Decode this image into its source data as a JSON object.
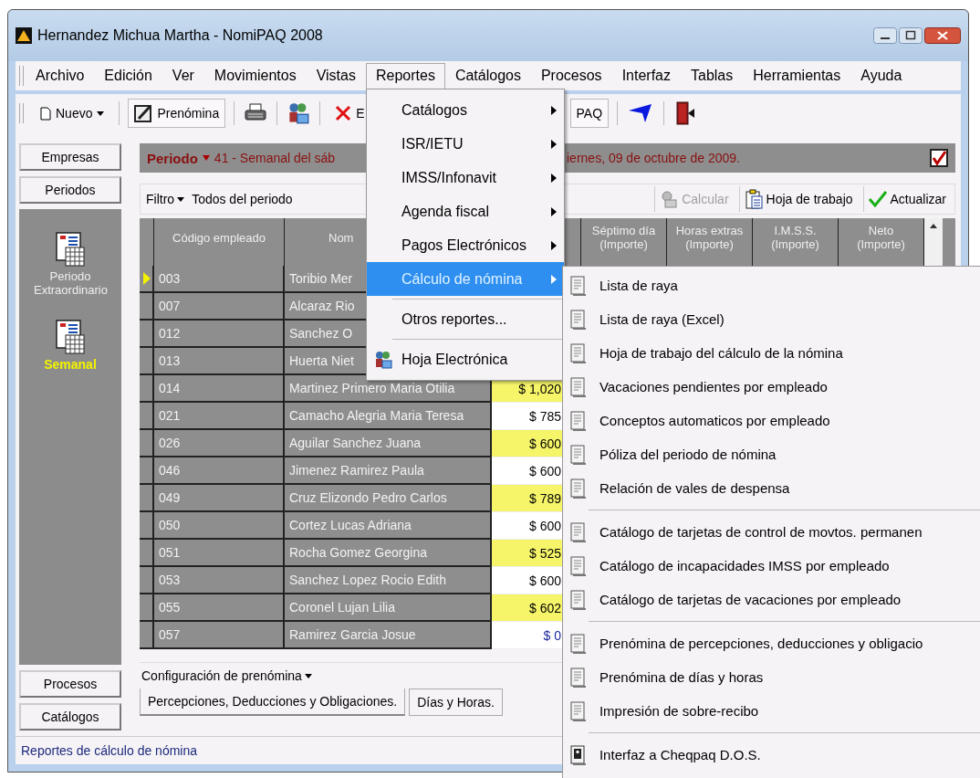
{
  "window": {
    "title": "Hernandez Michua Martha - NomiPAQ 2008"
  },
  "menubar": [
    {
      "label": "Archivo",
      "selected": false
    },
    {
      "label": "Edición",
      "selected": false
    },
    {
      "label": "Ver",
      "selected": false
    },
    {
      "label": "Movimientos",
      "selected": false
    },
    {
      "label": "Vistas",
      "selected": false
    },
    {
      "label": "Reportes",
      "selected": true
    },
    {
      "label": "Catálogos",
      "selected": false
    },
    {
      "label": "Procesos",
      "selected": false
    },
    {
      "label": "Interfaz",
      "selected": false
    },
    {
      "label": "Tablas",
      "selected": false
    },
    {
      "label": "Herramientas",
      "selected": false
    },
    {
      "label": "Ayuda",
      "selected": false
    }
  ],
  "reports_menu": [
    {
      "kind": "submenu",
      "label": "Catálogos",
      "selected": false
    },
    {
      "kind": "submenu",
      "label": "ISR/IETU",
      "selected": false
    },
    {
      "kind": "submenu",
      "label": "IMSS/Infonavit",
      "selected": false
    },
    {
      "kind": "submenu",
      "label": "Agenda fiscal",
      "selected": false
    },
    {
      "kind": "submenu",
      "label": "Pagos Electrónicos",
      "selected": false
    },
    {
      "kind": "submenu",
      "label": "Cálculo de nómina",
      "selected": true
    },
    {
      "kind": "separator"
    },
    {
      "kind": "command",
      "label": "Otros reportes...",
      "selected": false
    },
    {
      "kind": "separator"
    },
    {
      "kind": "icon-command",
      "label": "Hoja Electrónica",
      "selected": false
    }
  ],
  "payroll_submenu": [
    {
      "kind": "report",
      "label": "Lista de raya"
    },
    {
      "kind": "report",
      "label": "Lista de raya (Excel)"
    },
    {
      "kind": "report",
      "label": "Hoja de trabajo del cálculo de la nómina"
    },
    {
      "kind": "report",
      "label": "Vacaciones pendientes por empleado"
    },
    {
      "kind": "report",
      "label": "Conceptos automaticos por empleado"
    },
    {
      "kind": "report",
      "label": "Póliza del periodo de nómina"
    },
    {
      "kind": "report",
      "label": "Relación de vales de despensa"
    },
    {
      "kind": "separator"
    },
    {
      "kind": "report",
      "label": "Catálogo de tarjetas de control de movtos. permanen"
    },
    {
      "kind": "report",
      "label": "Catálogo de incapacidades IMSS por empleado"
    },
    {
      "kind": "report",
      "label": "Catálogo de tarjetas de vacaciones por empleado"
    },
    {
      "kind": "separator"
    },
    {
      "kind": "report",
      "label": "Prenómina de percepciones, deducciones y obligacio"
    },
    {
      "kind": "report",
      "label": "Prenómina de días y horas"
    },
    {
      "kind": "report",
      "label": "Impresión de sobre-recibo"
    },
    {
      "kind": "separator"
    },
    {
      "kind": "interface",
      "label": "Interfaz a Cheqpaq D.O.S."
    }
  ],
  "toolbar": {
    "new": "Nuevo",
    "prenomina": "Prenómina",
    "delete_partial": "E",
    "partial": "PAQ"
  },
  "sidebar": {
    "top_buttons": [
      "Empresas",
      "Periodos"
    ],
    "periods": [
      {
        "label": "Periodo Extraordinario",
        "selected": false
      },
      {
        "label": "Semanal",
        "selected": true
      }
    ],
    "bottom_buttons": [
      "Procesos",
      "Catálogos"
    ]
  },
  "period_bar": {
    "label": "Periodo",
    "text_start": "41 - Semanal del sáb",
    "text_end": "iernes, 09 de octubre de 2009.",
    "checked": true
  },
  "filter_bar": {
    "label": "Filtro",
    "value": "Todos del periodo",
    "buttons": [
      {
        "kind": "calculate",
        "label": "Calcular",
        "disabled": true
      },
      {
        "kind": "worksheet",
        "label": "Hoja de trabajo",
        "disabled": false
      },
      {
        "kind": "refresh",
        "label": "Actualizar",
        "disabled": false
      }
    ]
  },
  "table": {
    "left_columns": [
      "Código empleado",
      "Nom"
    ],
    "right_columns": [
      {
        "title": "Séptimo día",
        "unit": "(Importe)"
      },
      {
        "title": "Horas extras",
        "unit": "(Importe)"
      },
      {
        "title": "I.M.S.S.",
        "unit": "(Importe)"
      },
      {
        "title": "Neto",
        "unit": "(Importe)"
      }
    ],
    "rows": [
      {
        "code": "003",
        "name": "Toribio Mer",
        "selected": true
      },
      {
        "code": "007",
        "name": "Alcaraz Rio",
        "selected": false
      },
      {
        "code": "012",
        "name": "Sanchez O",
        "selected": false
      },
      {
        "code": "013",
        "name": "Huerta Niet",
        "selected": false
      },
      {
        "code": "014",
        "name": "Martinez Primero Maria Otilia",
        "amount": "$ 1,020",
        "highlight": true,
        "kind": "amount",
        "selected": false
      },
      {
        "code": "021",
        "name": "Camacho Alegria Maria Teresa",
        "amount": "$ 785",
        "highlight": false,
        "kind": "amount",
        "selected": false
      },
      {
        "code": "026",
        "name": "Aguilar Sanchez Juana",
        "amount": "$ 600",
        "highlight": true,
        "kind": "amount",
        "selected": false
      },
      {
        "code": "046",
        "name": "Jimenez Ramirez Paula",
        "amount": "$ 600",
        "highlight": false,
        "kind": "amount",
        "selected": false
      },
      {
        "code": "049",
        "name": "Cruz Elizondo Pedro Carlos",
        "amount": "$ 789",
        "highlight": true,
        "kind": "amount",
        "selected": false
      },
      {
        "code": "050",
        "name": "Cortez Lucas Adriana",
        "amount": "$ 600",
        "highlight": false,
        "kind": "amount",
        "selected": false
      },
      {
        "code": "051",
        "name": "Rocha Gomez Georgina",
        "amount": "$ 525",
        "highlight": true,
        "kind": "amount",
        "selected": false
      },
      {
        "code": "053",
        "name": "Sanchez  Lopez  Rocio Edith",
        "amount": "$ 600",
        "highlight": false,
        "kind": "amount",
        "selected": false
      },
      {
        "code": "055",
        "name": "Coronel Lujan Lilia",
        "amount": "$ 602",
        "highlight": true,
        "kind": "amount",
        "selected": false
      },
      {
        "code": "057",
        "name": "Ramirez Garcia Josue",
        "amount": "$ 0",
        "highlight": false,
        "kind": "zero",
        "selected": false
      }
    ]
  },
  "config_label": "Configuración de prenómina",
  "tabs": [
    {
      "label": "Percepciones, Deducciones y Obligaciones.",
      "selected": true
    },
    {
      "label": "Días y Horas.",
      "selected": false
    }
  ],
  "status_bar": "Reportes de cálculo de nómina"
}
